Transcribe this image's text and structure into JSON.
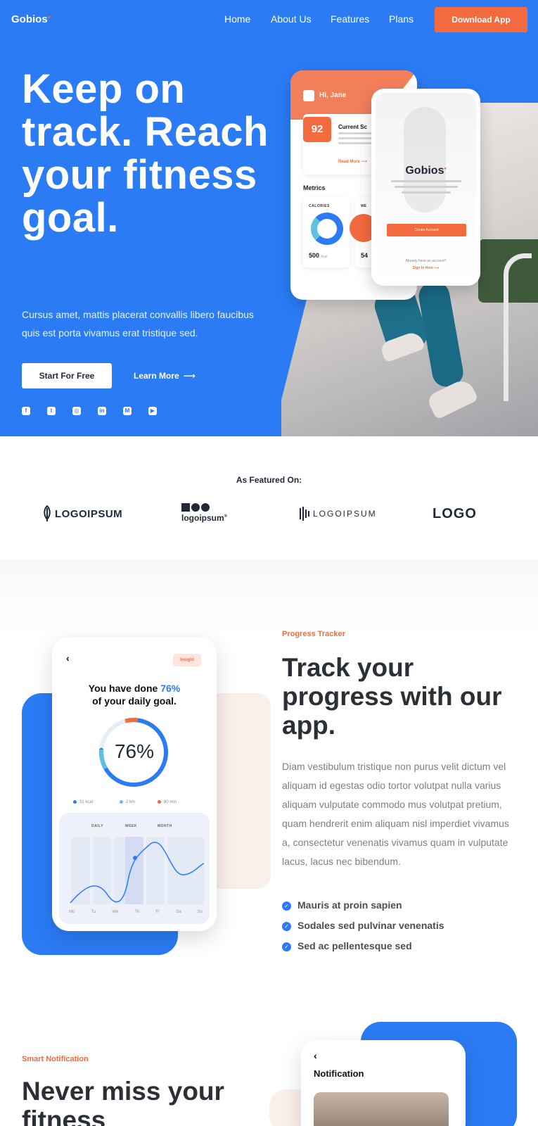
{
  "nav": {
    "logo": "Gobios",
    "logo_mark": "•",
    "links": [
      "Home",
      "About Us",
      "Features",
      "Plans"
    ],
    "cta": "Download App"
  },
  "hero": {
    "title": "Keep on track. Reach your fitness goal.",
    "subtitle": "Cursus amet, mattis placerat convallis libero faucibus quis est porta vivamus erat tristique sed.",
    "primary_button": "Start For Free",
    "secondary_link": "Learn More",
    "secondary_arrow": "⟶",
    "socials": [
      "facebook-icon",
      "twitter-icon",
      "instagram-icon",
      "linkedin-icon",
      "medium-icon",
      "youtube-icon"
    ],
    "social_glyphs": [
      "f",
      "t",
      "◎",
      "in",
      "M",
      "▶"
    ],
    "phone_left": {
      "greeting": "Hi, Jane",
      "score": "92",
      "score_label": "Current Sc",
      "read_more": "Read More ⟶",
      "metrics_label": "Metrics",
      "calories_label": "CALORIES",
      "calories_value": "500",
      "calories_unit": "kcal",
      "second_label": "WE",
      "second_value": "54"
    },
    "phone_right": {
      "logo": "Gobios",
      "logo_mark": "•",
      "button": "Create Account",
      "have_account": "Already have an account?",
      "sign_in": "Sign In Here ⟶"
    }
  },
  "featured": {
    "label": "As Featured On:",
    "logos": [
      "LOGOIPSUM",
      "logoipsum",
      "LOGOIPSUM",
      "LOGO"
    ],
    "logo2_mark": "®"
  },
  "progress": {
    "tag": "Progress Tracker",
    "title": "Track your progress with our app.",
    "body": "Diam vestibulum tristique non purus velit dictum vel aliquam id egestas odio tortor volutpat nulla varius aliquam vulputate commodo mus volutpat pretium, quam hendrerit enim aliquam nisl imperdiet vivamus a, consectetur venenatis vivamus quam in vulputate lacus, lacus nec bibendum.",
    "checks": [
      "Mauris at proin sapien",
      "Sodales sed pulvinar venenatis",
      "Sed ac pellentesque sed"
    ],
    "phone": {
      "back": "‹",
      "insight": "Insight",
      "title_a": "You have done ",
      "title_pct": "76%",
      "title_b": "of your daily goal.",
      "ring_value": "76%",
      "goal_fraction": 0.76,
      "legend": [
        "31 kcal",
        "2 km",
        "80 min"
      ],
      "legend_colors": [
        "#2a7bf4",
        "#5fc0e0",
        "#f26a3d"
      ],
      "tabs": [
        "DAILY",
        "WEEK",
        "MONTH"
      ],
      "days": [
        "Mo",
        "Tu",
        "We",
        "Th",
        "Fr",
        "Sa",
        "Su"
      ]
    }
  },
  "notification": {
    "tag": "Smart Notification",
    "title": "Never miss your fitness",
    "phone_back": "‹",
    "phone_title": "Notification"
  },
  "colors": {
    "brand_blue": "#2a7bf4",
    "accent_orange": "#f26a3d",
    "peach": "#fbefea"
  }
}
